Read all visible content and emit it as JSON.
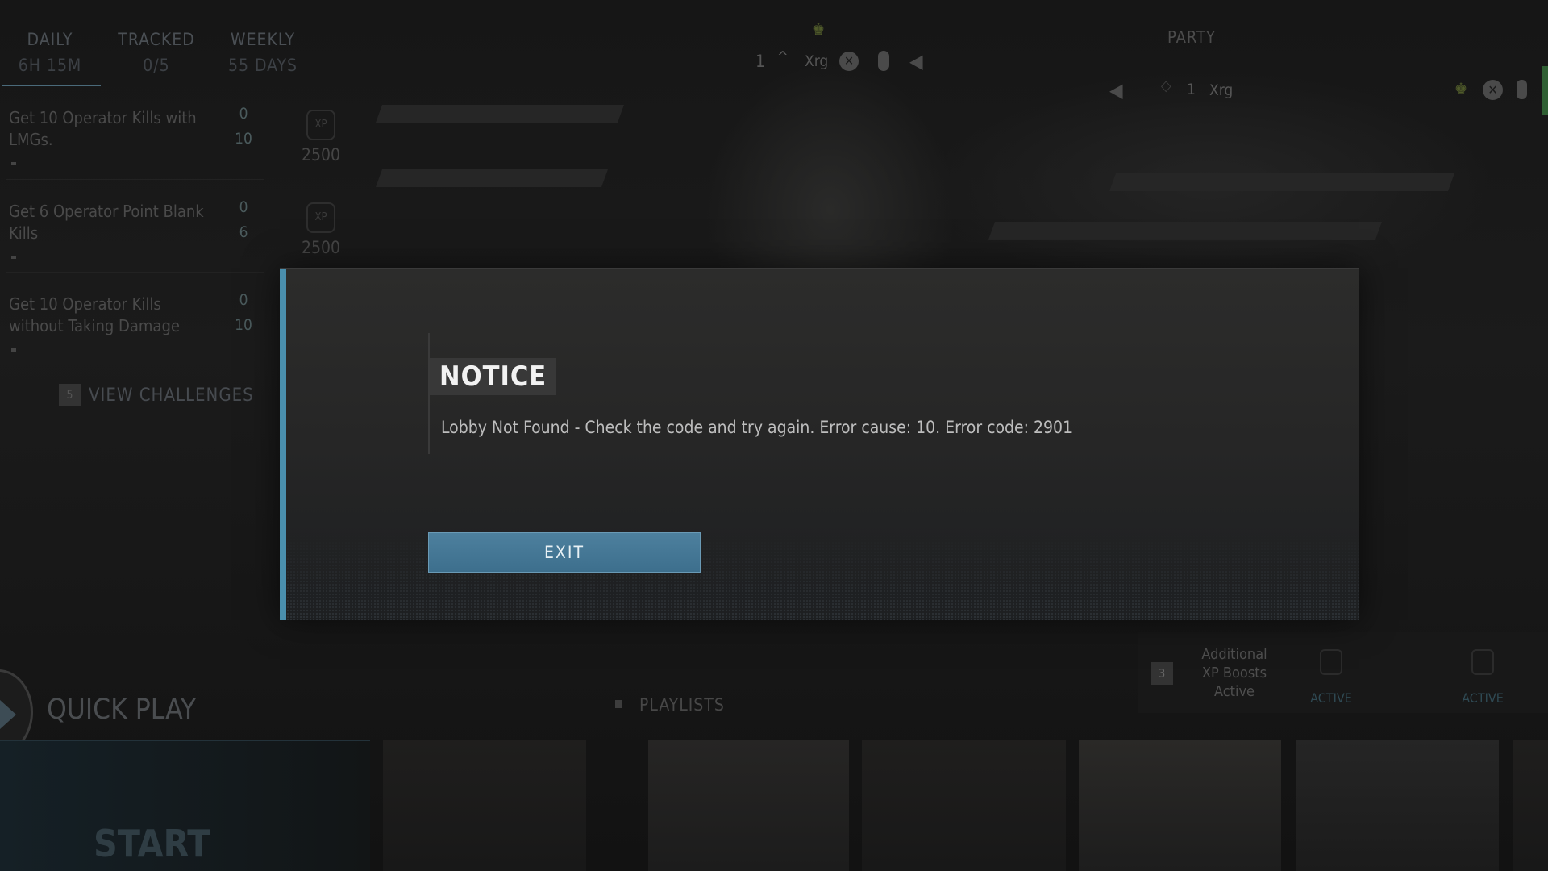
{
  "challenges": {
    "tabs": [
      {
        "label": "DAILY",
        "sub": "6H 15M"
      },
      {
        "label": "TRACKED",
        "sub": "0/5"
      },
      {
        "label": "WEEKLY",
        "sub": "55 DAYS"
      }
    ],
    "items": [
      {
        "title": "Get 10 Operator Kills with LMGs.",
        "progress": "0",
        "target": "10",
        "xp_label": "XP",
        "xp": "2500"
      },
      {
        "title": "Get 6 Operator Point Blank Kills",
        "progress": "0",
        "target": "6",
        "xp_label": "XP",
        "xp": "2500"
      },
      {
        "title": "Get 10 Operator Kills without Taking Damage",
        "progress": "0",
        "target": "10"
      }
    ],
    "view_key": "5",
    "view_label": "VIEW CHALLENGES"
  },
  "player": {
    "level": "1",
    "name": "Xrg",
    "icons": [
      "crown-skull-icon",
      "rank-chevron-icon",
      "xbox-icon",
      "mouse-icon",
      "speaker-icon"
    ]
  },
  "party": {
    "title": "PARTY",
    "member": {
      "level": "1",
      "name": "Xrg"
    },
    "accent": "#3a8a3a"
  },
  "dialog": {
    "title": "NOTICE",
    "message": "Lobby Not Found - Check the code and try again. Error cause: 10. Error code: 2901",
    "exit_label": "EXIT",
    "accent": "#4a8fad"
  },
  "bottom": {
    "quick_play": "QUICK PLAY",
    "playlists": "PLAYLISTS",
    "start": "START",
    "boost_key": "3",
    "boost_text": [
      "Additional",
      "XP Boosts",
      "Active"
    ],
    "boost_status": [
      "ACTIVE",
      "ACTIVE"
    ]
  }
}
